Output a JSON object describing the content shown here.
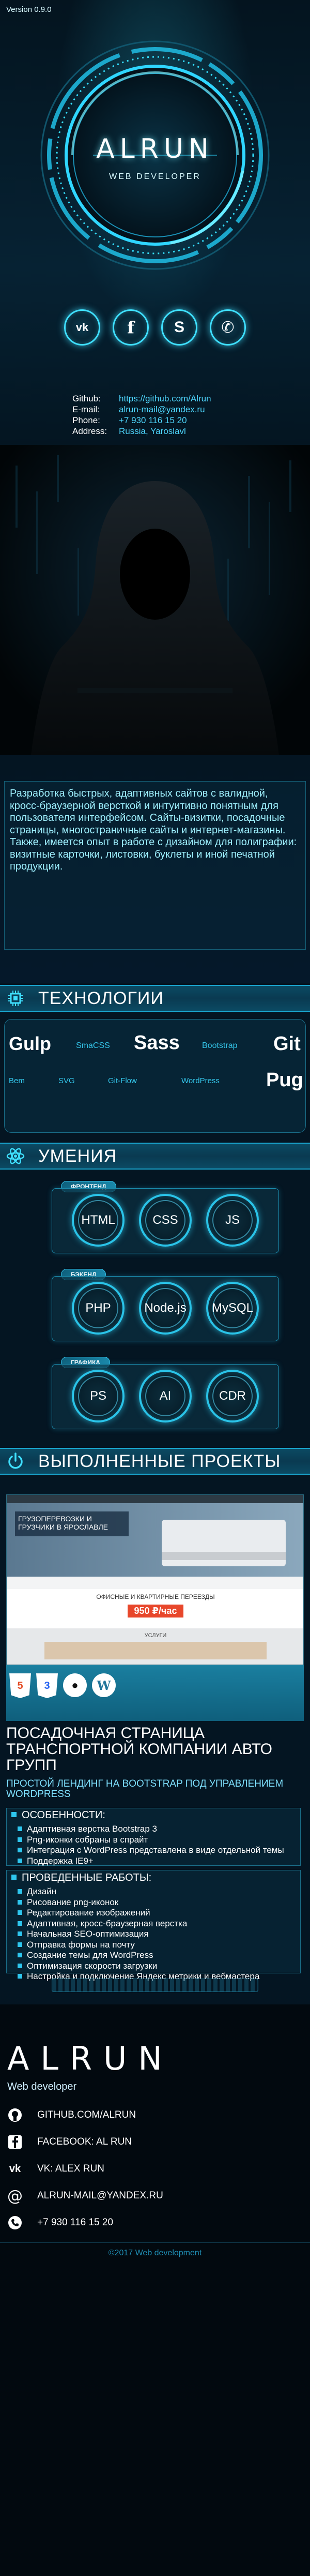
{
  "hero": {
    "version": "Version 0.9.0",
    "logo_title": "ALRUN",
    "logo_subtitle": "WEB DEVELOPER",
    "socials": [
      {
        "icon": "vk-icon",
        "glyph": "vk"
      },
      {
        "icon": "facebook-icon",
        "glyph": "f"
      },
      {
        "icon": "skype-icon",
        "glyph": "S"
      },
      {
        "icon": "phone-icon",
        "glyph": "✆"
      }
    ],
    "contacts": [
      {
        "key": "Github:",
        "value": "https://github.com/Alrun"
      },
      {
        "key": "E-mail:",
        "value": "alrun-mail@yandex.ru"
      },
      {
        "key": "Phone:",
        "value": "+7 930 116 15 20"
      },
      {
        "key": "Address:",
        "value": "Russia, Yaroslavl"
      }
    ]
  },
  "about": {
    "text": "Разработка быстрых, адаптивных сайтов с валидной, кросс-браузерной версткой и интуитивно понятным для пользователя интерфейсом. Сайты-визитки, посадочные страницы, многостраничные сайты и интернет-магазины. Также, имеется опыт в работе с дизайном для полиграфии: визитные карточки, листовки, буклеты и иной печатной продукции."
  },
  "tech": {
    "title": "ТЕХНОЛОГИИ",
    "tags": [
      "Gulp",
      "SmaCSS",
      "Sass",
      "Bootstrap",
      "Git",
      "Bem",
      "SVG",
      "Git-Flow",
      "WordPress",
      "Pug"
    ]
  },
  "skills": {
    "title": "УМЕНИЯ",
    "groups": [
      {
        "label": "ФРОНТЕНД",
        "items": [
          "HTML",
          "CSS",
          "JS"
        ]
      },
      {
        "label": "БЭКЕНД",
        "items": [
          "PHP",
          "Node.js",
          "MySQL"
        ]
      },
      {
        "label": "ГРАФИКА",
        "items": [
          "PS",
          "AI",
          "CDR"
        ]
      }
    ]
  },
  "projects": {
    "title": "ВЫПОЛНЕННЫЕ ПРОЕКТЫ",
    "shot_heading": "ГРУЗОПЕРЕВОЗКИ И ГРУЗЧИКИ В ЯРОСЛАВЛЕ",
    "shot_price_label": "ОФИСНЫЕ И КВАРТИРНЫЕ ПЕРЕЕЗДЫ",
    "shot_price": "950 ₽/час",
    "shot_services": "УСЛУГИ",
    "project_title": "ПОСАДОЧНАЯ СТРАНИЦА ТРАНСПОРТНОЙ КОМПАНИИ АВТО ГРУПП",
    "project_sub": "ПРОСТОЙ ЛЕНДИНГ НА BOOTSTRAP ПОД УПРАВЛЕНИЕМ WORDPRESS",
    "features_head": "ОСОБЕННОСТИ:",
    "features": [
      "Адаптивная верстка Bootstrap 3",
      "Png-иконки собраны в спрайт",
      "Интеграция с WordPress представлена в виде отдельной темы",
      "Поддержка IE9+"
    ],
    "works_head": "ПРОВЕДЕННЫЕ РАБОТЫ:",
    "works": [
      "Дизайн",
      "Рисование png-иконок",
      "Редактирование изображений",
      "Адаптивная, кросс-браузерная верстка",
      "Начальная SEO-оптимизация",
      "Отправка формы на почту",
      "Создание темы для WordPress",
      "Оптимизация скорости загрузки",
      "Настройка и подключение Яндекс метрики и вебмастера"
    ]
  },
  "footer": {
    "logo": "ALRUN",
    "subtitle": "Web developer",
    "links": [
      {
        "icon": "github-icon",
        "label": "GITHUB.COM/ALRUN"
      },
      {
        "icon": "facebook-icon",
        "label": "FACEBOOK: AL RUN"
      },
      {
        "icon": "vk-icon",
        "label": "VK: ALEX RUN"
      },
      {
        "icon": "email-icon",
        "label": "ALRUN-MAIL@YANDEX.RU"
      },
      {
        "icon": "phone-icon",
        "label": "+7 930 116 15 20"
      }
    ],
    "copyright": "©2017 Web development"
  },
  "colors": {
    "background": "#041522",
    "accent": "#2ac3e8",
    "text_accent": "#8fe9ff"
  }
}
